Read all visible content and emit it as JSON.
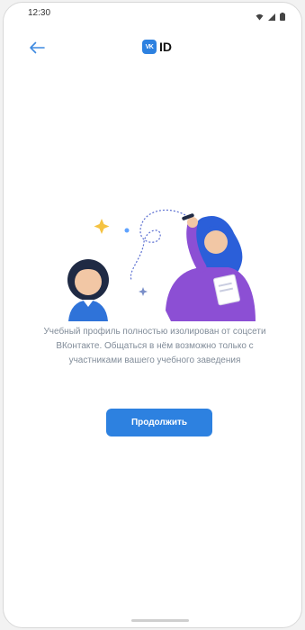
{
  "status_bar": {
    "time": "12:30",
    "icons": [
      "wifi-icon",
      "signal-icon",
      "battery-icon"
    ]
  },
  "header": {
    "back_icon": "arrow-left-icon",
    "logo_badge": "VK",
    "logo_text": "ID"
  },
  "main": {
    "message": "Учебный профиль полностью изолирован от соцсети ВКонтакте. Общаться в нём возможно только с участниками вашего учебного заведения",
    "continue_label": "Продолжить"
  },
  "colors": {
    "accent": "#2d81e0",
    "text_secondary": "#818c99",
    "illustration_purple": "#8c4fd4",
    "illustration_blue": "#2b5fd9"
  }
}
